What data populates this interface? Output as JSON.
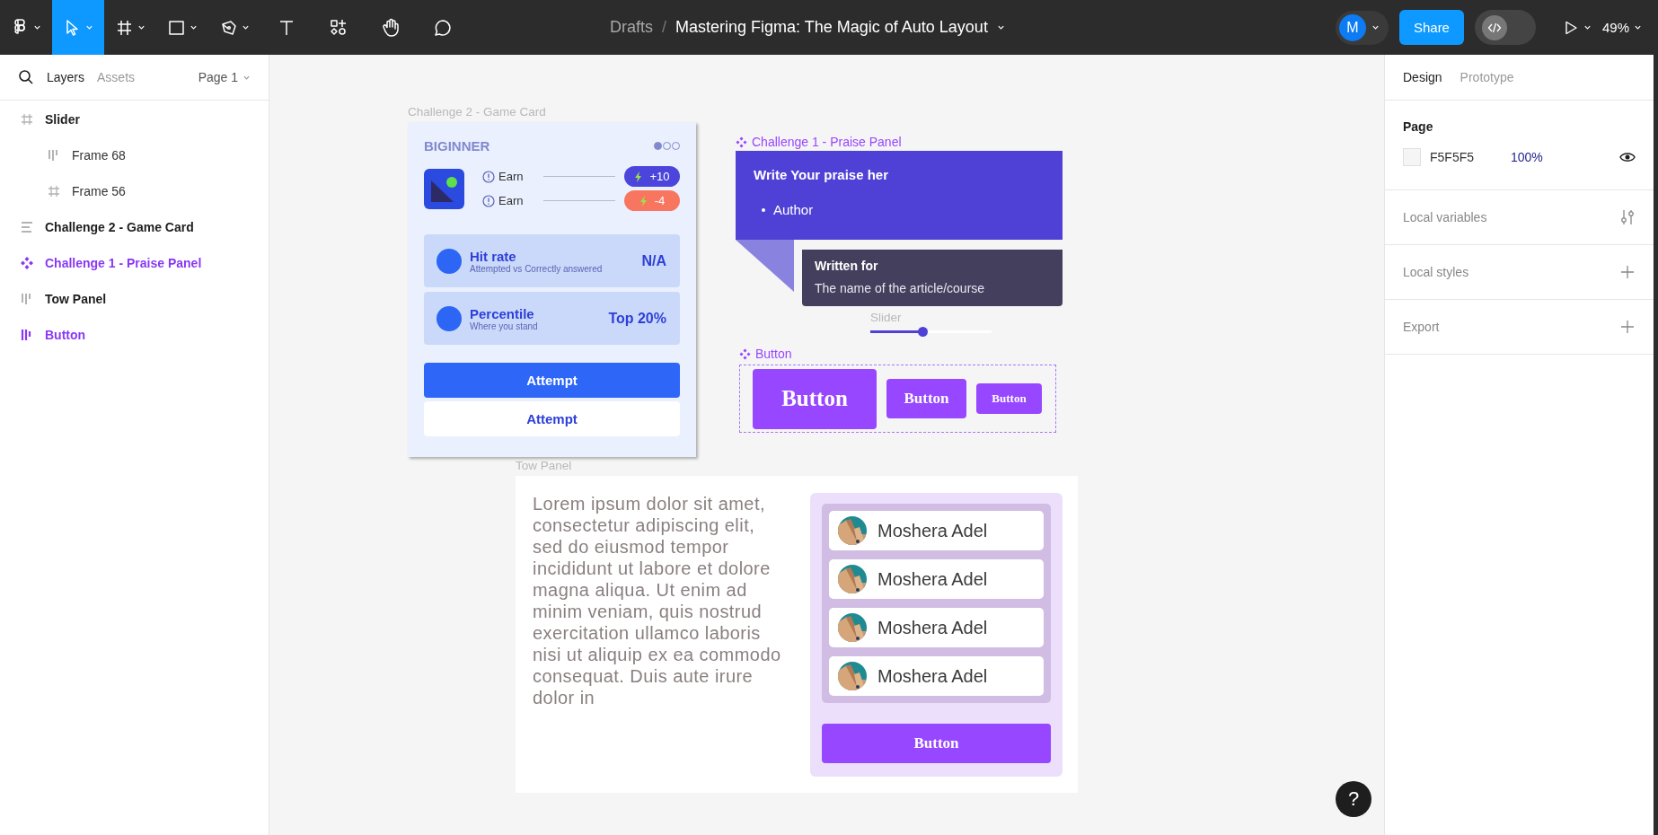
{
  "toolbar": {
    "tools": [
      {
        "kind": "main-menu",
        "selected": false
      },
      {
        "kind": "move",
        "selected": true
      },
      {
        "kind": "frame",
        "selected": false
      },
      {
        "kind": "shape",
        "selected": false
      },
      {
        "kind": "pen",
        "selected": false
      },
      {
        "kind": "text",
        "selected": false
      },
      {
        "kind": "resources",
        "selected": false
      },
      {
        "kind": "hand",
        "selected": false
      },
      {
        "kind": "comment",
        "selected": false
      }
    ],
    "breadcrumb": {
      "folder": "Drafts",
      "separator": "/",
      "title": "Mastering Figma: The Magic of Auto Layout"
    },
    "avatar": "M",
    "share": "Share",
    "dev_mode": {
      "on": false
    },
    "zoom": "49%"
  },
  "layers_panel": {
    "tabs": [
      {
        "label": "Layers",
        "selected": true
      },
      {
        "label": "Assets",
        "selected": false
      }
    ],
    "page": "Page 1",
    "layers": [
      {
        "name": "Slider",
        "kind": "frame",
        "children": [
          {
            "name": "Frame 68",
            "kind": "row-layout"
          },
          {
            "name": "Frame 56",
            "kind": "frame"
          }
        ]
      },
      {
        "name": "Challenge 2 - Game Card",
        "kind": "column-layout"
      },
      {
        "name": "Challenge 1 - Praise Panel",
        "kind": "component"
      },
      {
        "name": "Tow Panel",
        "kind": "row-layout"
      },
      {
        "name": "Button",
        "kind": "component-layout"
      }
    ]
  },
  "canvas": {
    "game_card": {
      "label": "Challenge 2 - Game Card",
      "level_title": "BIGINNER",
      "pager": [
        {
          "selected": true
        },
        {
          "selected": false
        },
        {
          "selected": false
        }
      ],
      "rewards": [
        {
          "label": "Earn",
          "value": "+10",
          "color": "#4b45dc"
        },
        {
          "label": "Earn",
          "value": "-4",
          "color": "#f8765f"
        }
      ],
      "stats": [
        {
          "title": "Hit rate",
          "subtitle": "Attempted vs Correctly answered",
          "value": "N/A"
        },
        {
          "title": "Percentile",
          "subtitle": "Where you stand",
          "value": "Top 20%"
        }
      ],
      "buttons": [
        {
          "label": "Attempt",
          "kind": "primary"
        },
        {
          "label": "Attempt",
          "kind": "secondary"
        }
      ]
    },
    "praise_panel": {
      "label": "Challenge 1 - Praise Panel",
      "heading": "Write Your praise her",
      "bullets": [
        "Author"
      ],
      "subheading": "Written for",
      "subtext": "The name of the article/course"
    },
    "slider": {
      "label": "Slider",
      "level": 0.43
    },
    "button_set": {
      "label": "Button",
      "buttons": [
        {
          "label": "Button",
          "kind": "large"
        },
        {
          "label": "Button",
          "kind": "medium"
        },
        {
          "label": "Button",
          "kind": "small"
        }
      ]
    },
    "tow_panel": {
      "label": "Tow Panel",
      "text": "Lorem ipsum dolor sit amet, consectetur adipiscing elit, sed do eiusmod tempor incididunt ut labore et dolore magna aliqua. Ut enim ad minim veniam, quis nostrud exercitation ullamco laboris nisi ut aliquip ex ea commodo consequat. Duis aute irure dolor in",
      "people": [
        {
          "name": "Moshera Adel"
        },
        {
          "name": "Moshera Adel"
        },
        {
          "name": "Moshera Adel"
        },
        {
          "name": "Moshera Adel"
        }
      ],
      "button": "Button"
    }
  },
  "design_panel": {
    "tabs": [
      {
        "label": "Design",
        "selected": true
      },
      {
        "label": "Prototype",
        "selected": false
      }
    ],
    "section": "Page",
    "fill": {
      "hex": "F5F5F5",
      "opacity": "100%",
      "visible": true
    },
    "sections": [
      {
        "label": "Local variables",
        "kind": "variables"
      },
      {
        "label": "Local styles",
        "kind": "add"
      },
      {
        "label": "Export",
        "kind": "add"
      }
    ]
  },
  "help": "?"
}
